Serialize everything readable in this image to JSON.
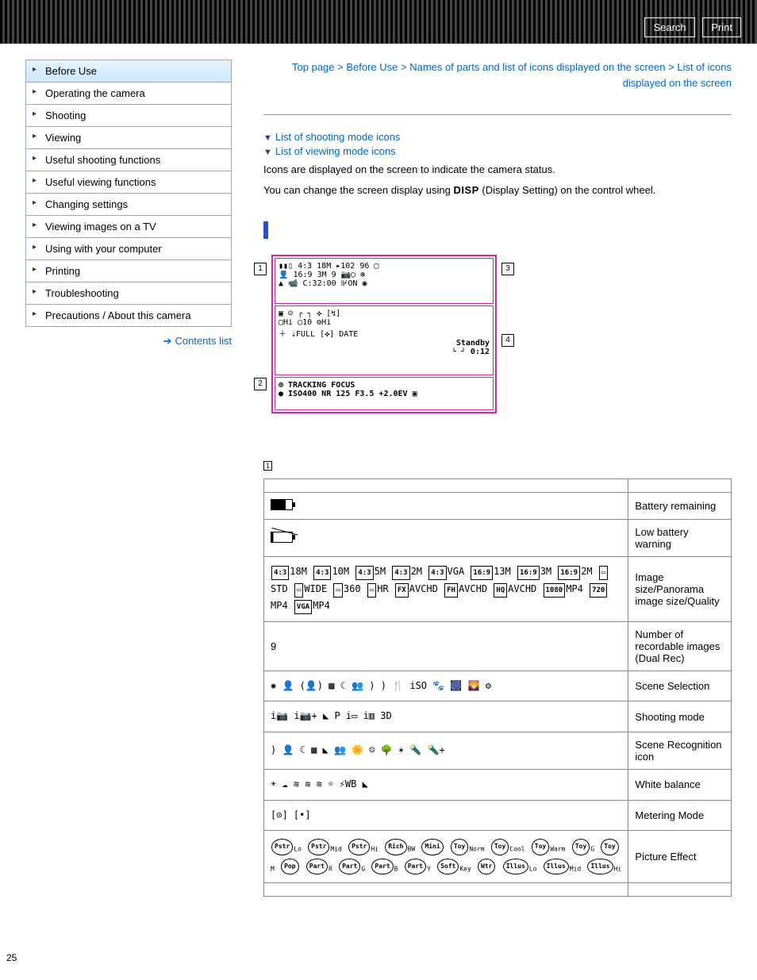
{
  "banner": {
    "search": "Search",
    "print": "Print"
  },
  "sidebar": {
    "items": [
      "Before Use",
      "Operating the camera",
      "Shooting",
      "Viewing",
      "Useful shooting functions",
      "Useful viewing functions",
      "Changing settings",
      "Viewing images on a TV",
      "Using with your computer",
      "Printing",
      "Troubleshooting",
      "Precautions / About this camera"
    ],
    "contents": "Contents list"
  },
  "crumb": {
    "top": "Top page",
    "bu": "Before Use",
    "names": "Names of parts and list of icons displayed on the screen",
    "list": "List of icons displayed on the screen",
    "sep": " > "
  },
  "links": {
    "shoot": "List of shooting mode icons",
    "view": "List of viewing mode icons"
  },
  "body": {
    "p1": "Icons are displayed on the screen to indicate the camera status.",
    "p2a": "You can change the screen display using ",
    "disp": "DISP",
    "p2b": " (Display Setting) on the control wheel."
  },
  "diagram": {
    "c1": "1",
    "c2": "2",
    "c3": "3",
    "c4": "4",
    "a1_l1": "▮▮▯   4:3 18M   ▸102     96 ▢",
    "a1_l2": "👤    16:9 3M  9  📷◯       ⊛",
    "a1_l3": "▲     📹 C:32:00   ⊮ON  ◉",
    "a3_l1": "▣ ☺  ┌        ┐   ✜ [↯]",
    "a3_l2": "▢Hi     ◯10        ⚙Hi",
    "a3_l3": "        ＋    ⇣FULL [✜] DATE",
    "a3_l4": "                  Standby",
    "a3_l5": " └        ┘       0:12",
    "a2_l1": "   ⊕ TRACKING FOCUS",
    "a2_l2": "● ISO400  NR  125   F3.5  +2.0EV  ▣"
  },
  "table": {
    "r1": {
      "desc": "Battery remaining"
    },
    "r2": {
      "desc": "Low battery warning"
    },
    "r3": {
      "icons": "4:3 18M  4:3 10M  4:3 5M  4:3 2M  4:3 VGA  16:9 13M  16:9 3M  16:9 2M  ▭ STD  ▭ WIDE  ▭ 360  ▭ HR  FX AVCHD  FH AVCHD  HQ AVCHD  1080 MP4  720 MP4  VGA MP4",
      "desc": "Image size/Panorama image size/Quality"
    },
    "r4": {
      "icons": "9",
      "desc": "Number of recordable images (Dual Rec)"
    },
    "r5": {
      "icons": "✺ 👤 (👤) ▩ ☾ 👥 ) ) 🍴 iSO 🐾 🎆 🌄 ⚙",
      "desc": "Scene Selection"
    },
    "r6": {
      "icons": "i📷 i📷+ ◣ P i▭ i▥ 3D",
      "desc": "Shooting mode"
    },
    "r7": {
      "icons": ") 👤 ☾ ▩ ◣ 👥 🌼 ☺ 🌳 ✶ 🔦 🔦+",
      "desc": "Scene Recognition icon"
    },
    "r8": {
      "icons": "☀ ☁ ≋ ≋ ≋ ☼ ⚡WB ◣",
      "desc": "White balance"
    },
    "r9": {
      "icons": "[⊙] [•]",
      "desc": "Metering Mode"
    },
    "r10": {
      "icons": "(Pstr)Lo (Pstr)Mid (Pstr)Hi (Rich)BW (Mini) (Toy)Norm (Toy)Cool (Toy)Warm (Toy)G (Toy)M (Pop) (Part)R (Part)G (Part)B (Part)Y (Soft)Key (Wtr) (Illus)Lo (Illus)Mid (Illus)Hi",
      "desc": "Picture Effect"
    }
  },
  "page": "25"
}
